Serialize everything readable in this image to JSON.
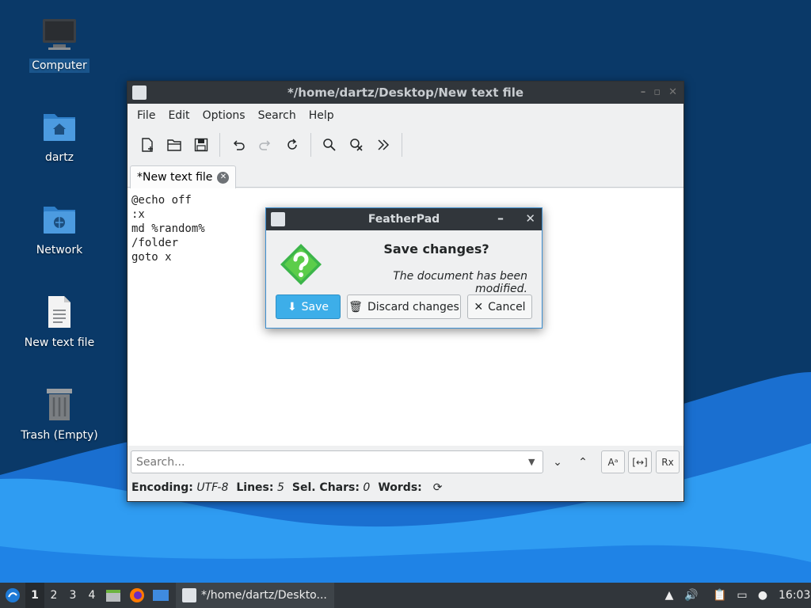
{
  "desktop": {
    "icons": [
      {
        "label": "Computer",
        "icon": "computer-icon"
      },
      {
        "label": "dartz",
        "icon": "home-folder-icon"
      },
      {
        "label": "Network",
        "icon": "network-folder-icon"
      },
      {
        "label": "New text file",
        "icon": "text-file-icon"
      },
      {
        "label": "Trash (Empty)",
        "icon": "trash-icon"
      }
    ],
    "colors": {
      "sky": "#0a3968",
      "wave_light": "#2a9af0",
      "wave_dark": "#0c63c9"
    }
  },
  "window": {
    "title": "*/home/dartz/Desktop/New text file",
    "menu": [
      "File",
      "Edit",
      "Options",
      "Search",
      "Help"
    ],
    "toolbar": [
      "new-document-icon",
      "open-folder-icon",
      "save-icon",
      "undo-icon",
      "redo-icon",
      "reload-icon",
      "find-icon",
      "replace-icon",
      "more-icon"
    ],
    "tab_label": "*New text file",
    "editor_lines": [
      "@echo off",
      ":x",
      "md %random%",
      "/folder",
      "goto x"
    ],
    "search_placeholder": "Search...",
    "search_buttons": {
      "match_case": "Aᵃ",
      "whole_word": "[↔]",
      "regex": "Rx"
    },
    "status": {
      "encoding_label": "Encoding:",
      "encoding_value": "UTF-8",
      "lines_label": "Lines:",
      "lines_value": "5",
      "sel_label": "Sel. Chars:",
      "sel_value": "0",
      "words_label": "Words:"
    }
  },
  "dialog": {
    "title": "FeatherPad",
    "heading": "Save changes?",
    "message": "The document has been modified.",
    "buttons": {
      "save": "Save",
      "discard": "Discard changes",
      "cancel": "Cancel"
    },
    "accent": "#3daee9"
  },
  "taskbar": {
    "workspaces": [
      "1",
      "2",
      "3",
      "4"
    ],
    "active_workspace": "1",
    "task_label": "*/home/dartz/Deskto...",
    "clock": "16:03"
  }
}
